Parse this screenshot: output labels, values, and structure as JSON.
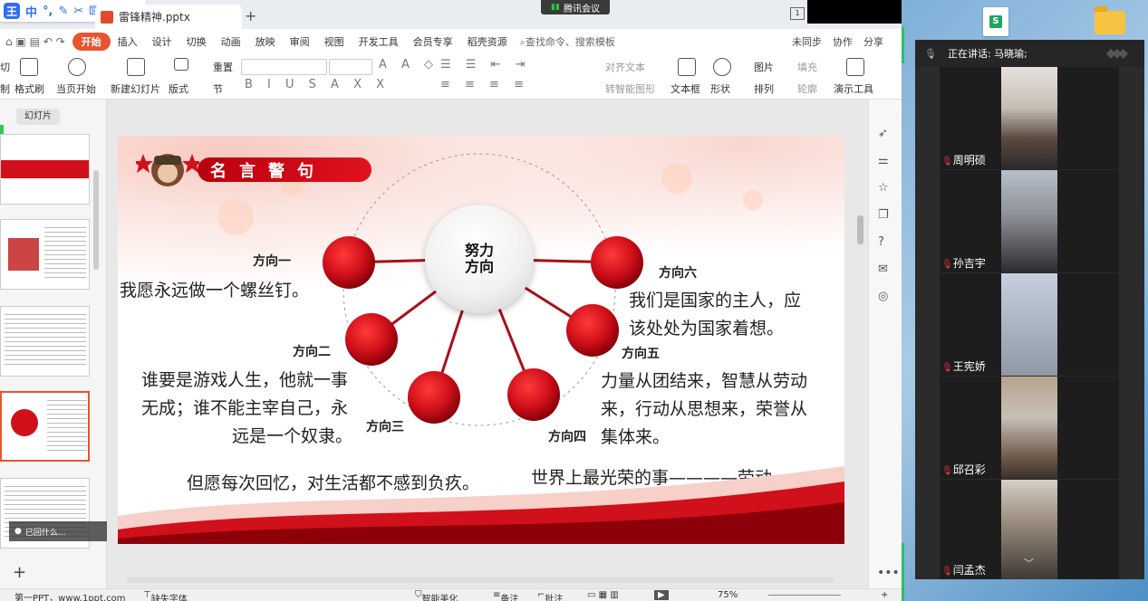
{
  "float_toolbar": {
    "logo": "王",
    "btn1": "中",
    "btn2": "°,"
  },
  "tab": {
    "title": "雷锋精神.pptx",
    "add": "+"
  },
  "tencent": {
    "label": "腾讯会议"
  },
  "window_icon": "1",
  "menu": {
    "tabs": [
      "开始",
      "插入",
      "设计",
      "切换",
      "动画",
      "放映",
      "审阅",
      "视图",
      "开发工具",
      "会员专享",
      "稻壳资源"
    ],
    "active": "开始",
    "search": "查找命令、搜索模板",
    "right": [
      "未同步",
      "协作",
      "分享"
    ]
  },
  "ribbon": {
    "cut": "切",
    "paste_label": "制",
    "format_painter": "格式刷",
    "from_current": "当页开始",
    "new_slide": "新建幻灯片",
    "layout": "版式",
    "section": "节",
    "reset": "重置",
    "text_align": "对齐文本",
    "smartart": "转智能图形",
    "textbox": "文本框",
    "shape": "形状",
    "picture": "图片",
    "arrange": "排列",
    "fill": "填充",
    "outline": "轮廓",
    "presenter": "演示工具"
  },
  "left_panel": {
    "tab": "幻灯片",
    "add": "+",
    "tip": "已回什么..."
  },
  "slide": {
    "title": "名言警句",
    "hub": [
      "努力",
      "方向"
    ],
    "directions": {
      "d1": "方向一",
      "d2": "方向二",
      "d3": "方向三",
      "d4": "方向四",
      "d5": "方向五",
      "d6": "方向六"
    },
    "quotes": {
      "q1": "我愿永远做一个螺丝钉。",
      "q2a": "谁要是游戏人生，他就一事",
      "q2b": "无成；谁不能主宰自己，永",
      "q2c": "远是一个奴隶。",
      "q3": "但愿每次回忆，对生活都不感到负疚。",
      "q4": "世界上最光荣的事————劳动。",
      "q5a": "力量从团结来，智慧从劳动",
      "q5b": "来，行动从思想来，荣誉从",
      "q5c": "集体来。",
      "q6a": "我们是国家的主人，应",
      "q6b": "该处处为国家着想。"
    }
  },
  "meeting": {
    "speaking": "正在讲话: 马晓瑜;",
    "participants": [
      "周明硕",
      "孙吉宇",
      "王宪娇",
      "邱召彩",
      "闫孟杰"
    ]
  },
  "status": {
    "left": "第一PPT，www.1ppt.com",
    "font": "缺失字体",
    "beautify": "智能美化",
    "notes": "备注",
    "annot": "批注",
    "zoom": "75%",
    "plus": "+"
  },
  "colors": {
    "accent": "#e8542e",
    "slide_red": "#d0101a"
  }
}
